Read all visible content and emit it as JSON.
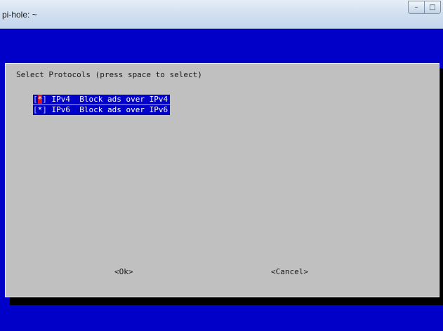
{
  "window": {
    "title": "pi-hole: ~",
    "controls": [
      "minimize",
      "maximize"
    ]
  },
  "colors": {
    "terminal_background": "#0000c8",
    "dialog_background": "#c0c0c0",
    "selection_background": "#0000c8",
    "cursor_highlight": "#d01818"
  },
  "dialog": {
    "title": "Select Protocols (press space to select)",
    "options": [
      {
        "bracket_open": "[",
        "mark": "*",
        "bracket_close": "]",
        "tag": "IPv4",
        "description": "Block ads over IPv4",
        "selected": true,
        "focused": true
      },
      {
        "bracket_open": "[",
        "mark": "*",
        "bracket_close": "]",
        "tag": "IPv6",
        "description": "Block ads over IPv6",
        "selected": true,
        "focused": false
      }
    ],
    "ok_label": "<Ok>",
    "cancel_label": "<Cancel>"
  }
}
